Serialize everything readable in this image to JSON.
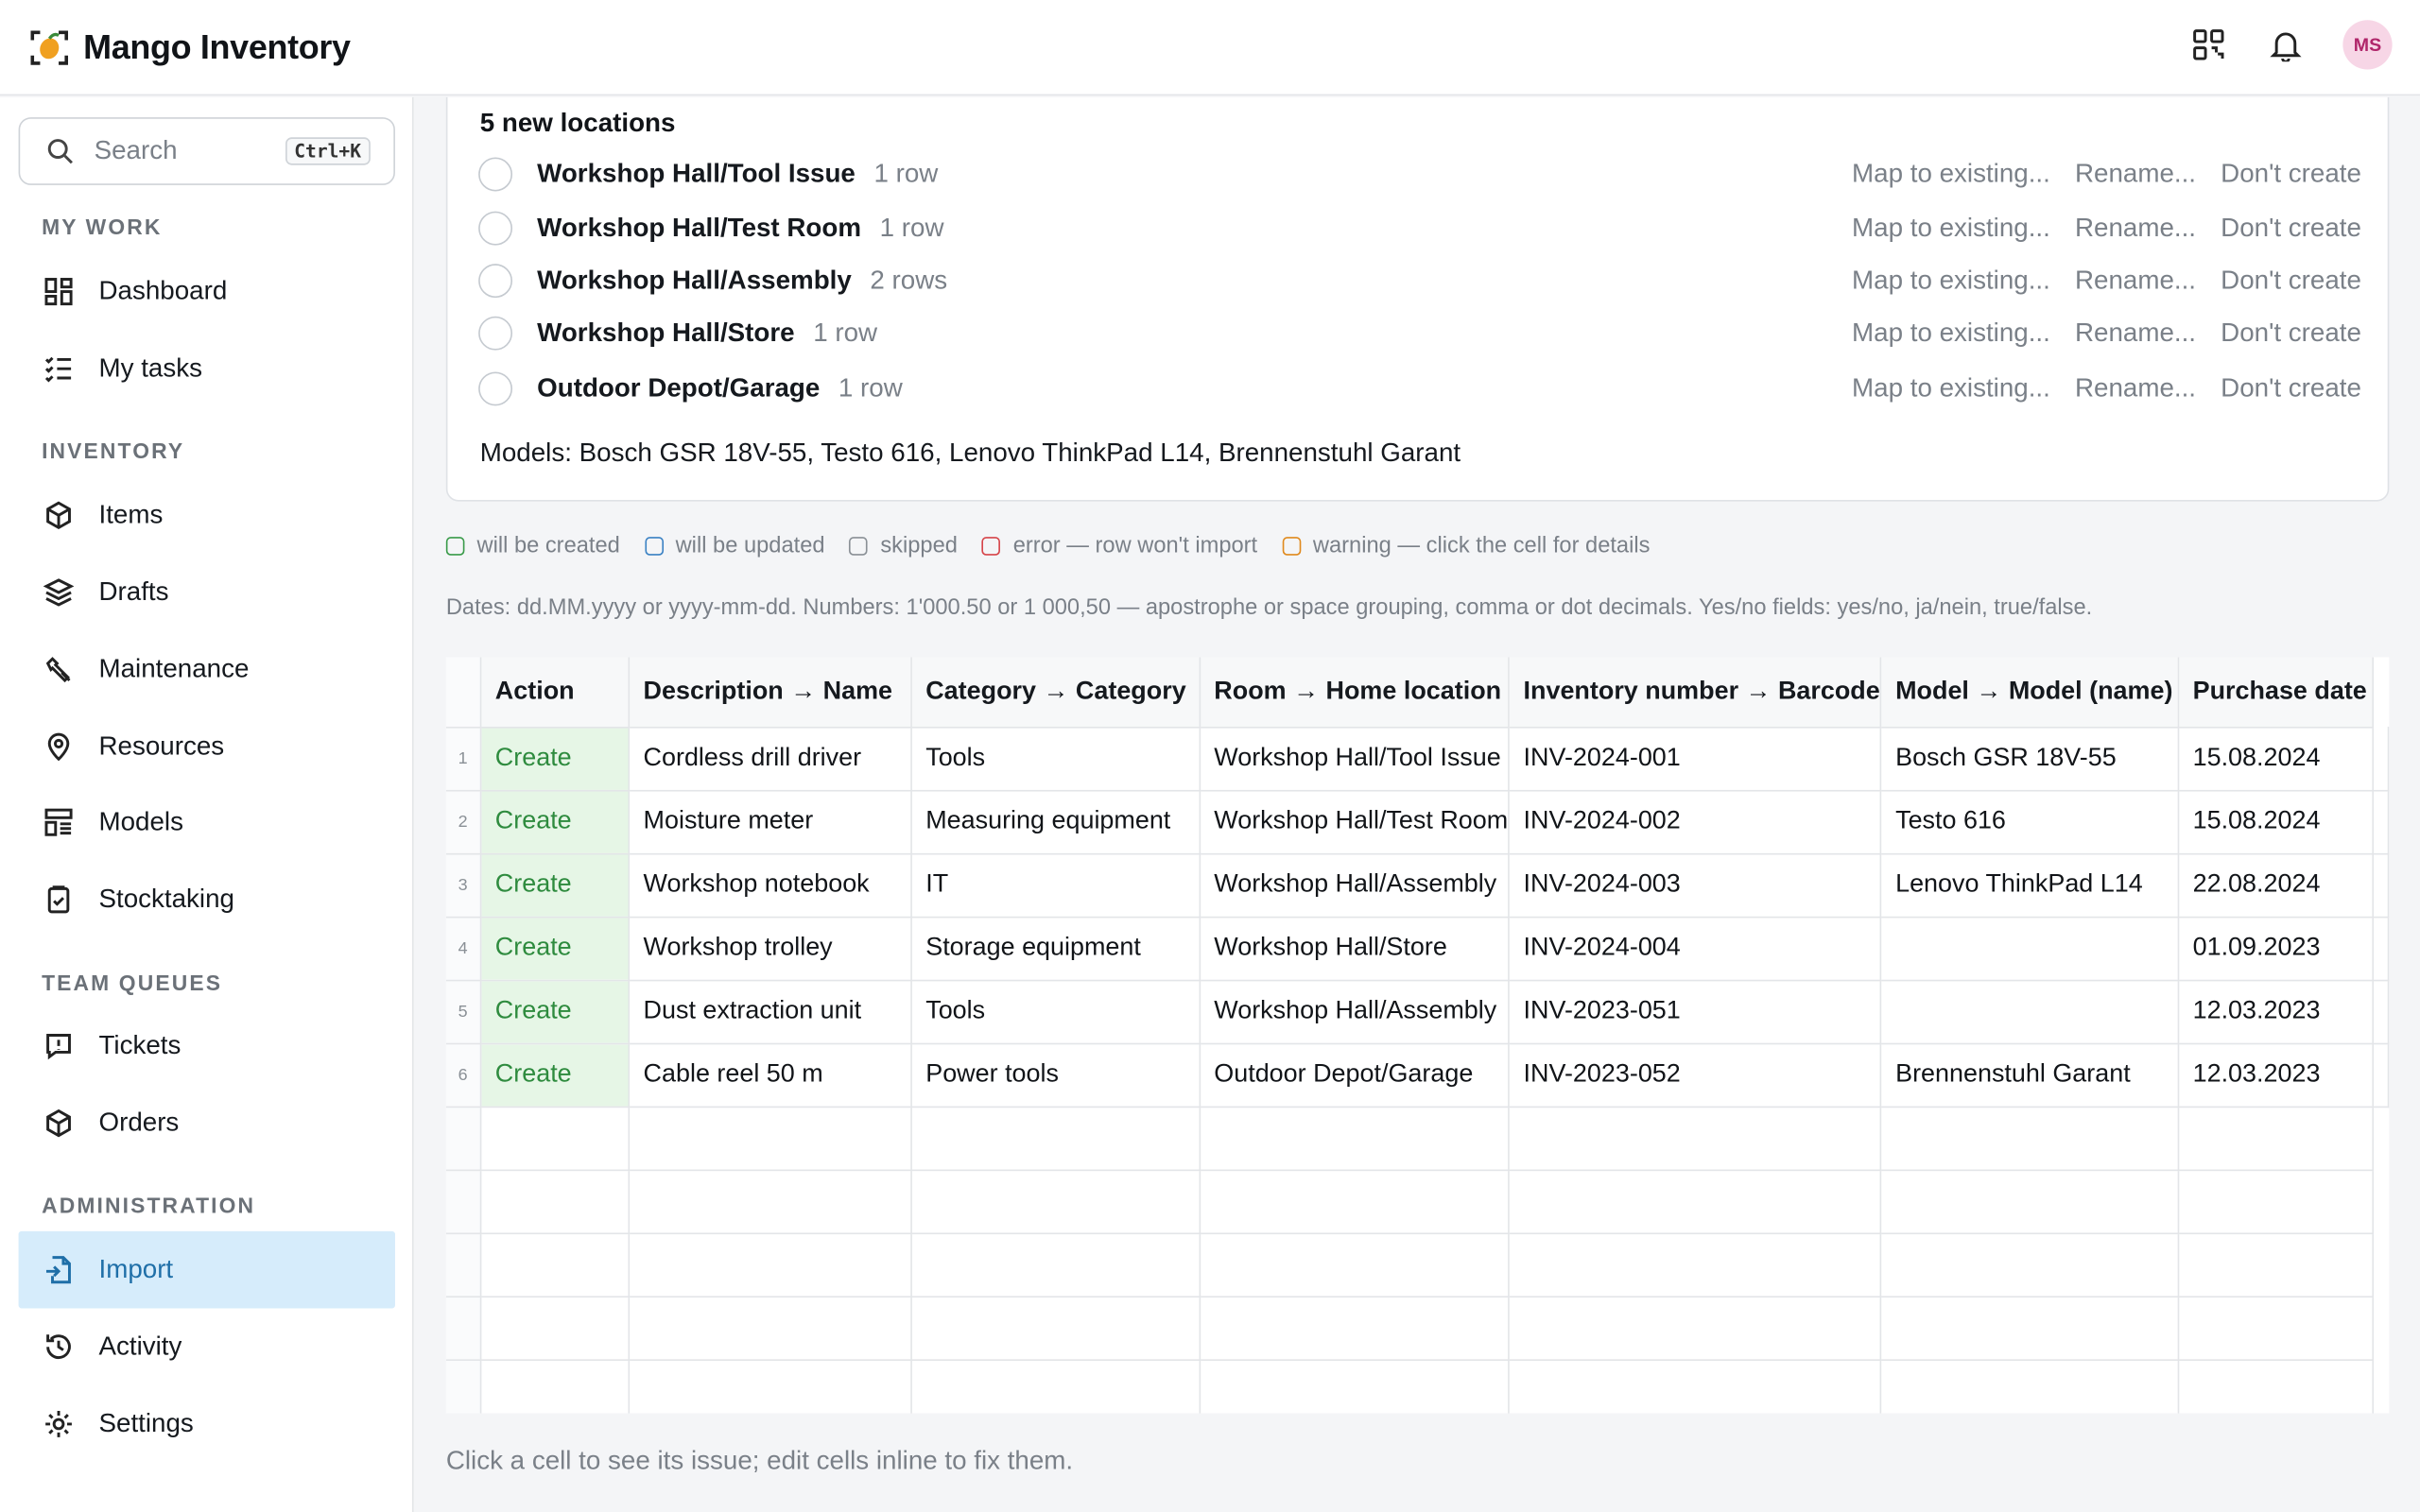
{
  "app": {
    "title": "Mango Inventory",
    "avatar_initials": "MS",
    "accent": "#1f6fa8",
    "brand_color": "#f0a020"
  },
  "search": {
    "placeholder": "Search",
    "shortcut": "Ctrl+K"
  },
  "sidebar": {
    "sections": [
      {
        "label": "MY WORK"
      },
      {
        "label": "INVENTORY"
      },
      {
        "label": "TEAM QUEUES"
      },
      {
        "label": "ADMINISTRATION"
      }
    ],
    "items": [
      {
        "label": "Dashboard",
        "icon": "dashboard-icon"
      },
      {
        "label": "My tasks",
        "icon": "tasks-icon"
      },
      {
        "label": "Items",
        "icon": "box-icon"
      },
      {
        "label": "Drafts",
        "icon": "layers-icon"
      },
      {
        "label": "Maintenance",
        "icon": "wrench-icon"
      },
      {
        "label": "Resources",
        "icon": "location-pin-icon"
      },
      {
        "label": "Models",
        "icon": "models-icon"
      },
      {
        "label": "Stocktaking",
        "icon": "clipboard-check-icon"
      },
      {
        "label": "Tickets",
        "icon": "ticket-icon"
      },
      {
        "label": "Orders",
        "icon": "box-icon"
      },
      {
        "label": "Import",
        "icon": "file-import-icon",
        "active": true
      },
      {
        "label": "Activity",
        "icon": "history-icon"
      },
      {
        "label": "Settings",
        "icon": "gear-icon"
      }
    ]
  },
  "locations": {
    "heading": "5 new locations",
    "rows": [
      {
        "name": "Workshop Hall/Tool Issue",
        "count": "1 row"
      },
      {
        "name": "Workshop Hall/Test Room",
        "count": "1 row"
      },
      {
        "name": "Workshop Hall/Assembly",
        "count": "2 rows"
      },
      {
        "name": "Workshop Hall/Store",
        "count": "1 row"
      },
      {
        "name": "Outdoor Depot/Garage",
        "count": "1 row"
      }
    ],
    "action_map": "Map to existing...",
    "action_rename": "Rename...",
    "action_skip": "Don't create",
    "models_line": "Models: Bosch GSR 18V-55, Testo 616, Lenovo ThinkPad L14, Brennenstuhl Garant"
  },
  "legend": [
    {
      "label": "will be created",
      "color": "#3a9b4a"
    },
    {
      "label": "will be updated",
      "color": "#3b82c4"
    },
    {
      "label": "skipped",
      "color": "#8a9096"
    },
    {
      "label": "error — row won't import",
      "color": "#d6454a"
    },
    {
      "label": "warning — click the cell for details",
      "color": "#e08a1e"
    }
  ],
  "format_hint": "Dates: dd.MM.yyyy or yyyy-mm-dd. Numbers: 1'000.50 or 1 000,50 — apostrophe or space grouping, comma or dot decimals. Yes/no fields: yes/no, ja/nein, true/false.",
  "grid": {
    "columns": [
      "Action",
      "Description → Name",
      "Category → Category",
      "Room → Home location",
      "Inventory number → Barcode",
      "Model → Model (name)",
      "Purchase date"
    ],
    "rows": [
      {
        "n": "1",
        "cells": [
          "Create",
          "Cordless drill driver",
          "Tools",
          "Workshop Hall/Tool Issue",
          "INV-2024-001",
          "Bosch GSR 18V-55",
          "15.08.2024"
        ]
      },
      {
        "n": "2",
        "cells": [
          "Create",
          "Moisture meter",
          "Measuring equipment",
          "Workshop Hall/Test Room",
          "INV-2024-002",
          "Testo 616",
          "15.08.2024"
        ]
      },
      {
        "n": "3",
        "cells": [
          "Create",
          "Workshop notebook",
          "IT",
          "Workshop Hall/Assembly",
          "INV-2024-003",
          "Lenovo ThinkPad L14",
          "22.08.2024"
        ]
      },
      {
        "n": "4",
        "cells": [
          "Create",
          "Workshop trolley",
          "Storage equipment",
          "Workshop Hall/Store",
          "INV-2024-004",
          "",
          "01.09.2023"
        ]
      },
      {
        "n": "5",
        "cells": [
          "Create",
          "Dust extraction unit",
          "Tools",
          "Workshop Hall/Assembly",
          "INV-2023-051",
          "",
          "12.03.2023"
        ]
      },
      {
        "n": "6",
        "cells": [
          "Create",
          "Cable reel 50 m",
          "Power tools",
          "Outdoor Depot/Garage",
          "INV-2023-052",
          "Brennenstuhl Garant",
          "12.03.2023"
        ]
      }
    ]
  },
  "footer_hint": "Click a cell to see its issue; edit cells inline to fix them."
}
